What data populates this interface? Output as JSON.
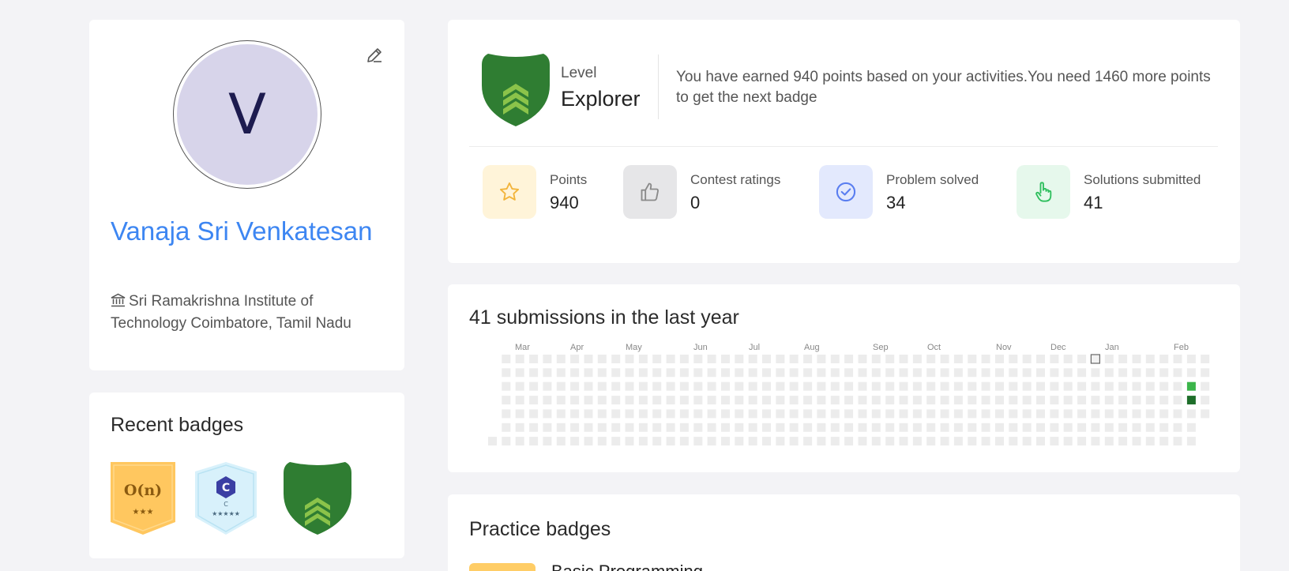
{
  "profile": {
    "avatar_letter": "V",
    "name": "Vanaja Sri Venkatesan",
    "institute": "Sri Ramakrishna Institute of Technology Coimbatore, Tamil Nadu",
    "edit_icon": "pencil-icon",
    "institute_icon": "bank-icon"
  },
  "recent_badges": {
    "title": "Recent badges",
    "items": [
      {
        "name": "complexity-badge",
        "text": "O(n)",
        "stars": "★★★",
        "color": "#ffc75f"
      },
      {
        "name": "c-language-badge",
        "text": "C",
        "subtext": "C",
        "stars": "★★★★★",
        "color": "#d8f1fb"
      },
      {
        "name": "explorer-level-badge",
        "color": "#2f7d32"
      }
    ]
  },
  "level": {
    "label": "Level",
    "value": "Explorer",
    "message": "You have earned 940 points based on your activities.You need 1460 more points to get the next badge"
  },
  "stats": [
    {
      "label": "Points",
      "value": "940",
      "icon": "star-icon",
      "bg": "#fff4d9",
      "color": "#f2b43a"
    },
    {
      "label": "Contest ratings",
      "value": "0",
      "icon": "thumbs-up-icon",
      "bg": "#e6e6e8",
      "color": "#8a8a8a"
    },
    {
      "label": "Problem solved",
      "value": "34",
      "icon": "check-circle-icon",
      "bg": "#e3e9fd",
      "color": "#5a7ef0"
    },
    {
      "label": "Solutions submitted",
      "value": "41",
      "icon": "pointer-hand-icon",
      "bg": "#e6f8ec",
      "color": "#2fbf5e"
    }
  ],
  "submissions": {
    "title": "41 submissions in the last year",
    "months": [
      "Mar",
      "Apr",
      "May",
      "Jun",
      "Jul",
      "Aug",
      "Sep",
      "Oct",
      "Nov",
      "Dec",
      "Jan",
      "Feb"
    ],
    "colors": {
      "empty": "#ececec",
      "low": "#3bb54a",
      "high": "#1e6e2a"
    },
    "active_cells": [
      {
        "week": 51,
        "day": 2,
        "level": "low"
      },
      {
        "week": 51,
        "day": 3,
        "level": "high"
      }
    ],
    "outlined_cell": {
      "week": 44,
      "day": 0
    }
  },
  "practice_badges": {
    "title": "Practice badges",
    "first_item": "Basic Programming"
  }
}
